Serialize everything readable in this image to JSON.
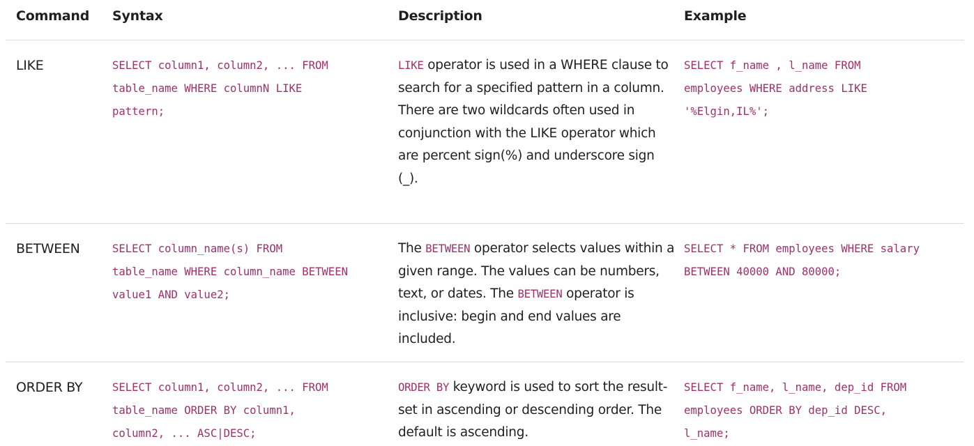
{
  "headers": {
    "command": "Command",
    "syntax": "Syntax",
    "description": "Description",
    "example": "Example"
  },
  "rows": [
    {
      "command": "LIKE",
      "syntax_lines": [
        "SELECT column1, column2, ... FROM",
        "table_name WHERE columnN LIKE",
        "pattern;"
      ],
      "description": {
        "kw1": "LIKE",
        "text1": " operator is used in a WHERE clause to search for a specified pattern in a column.",
        "text2": "There are two wildcards often used in conjunction with the LIKE operator which are percent sign(%) and underscore sign (_)."
      },
      "example_lines": [
        "SELECT f_name , l_name FROM",
        "employees WHERE address LIKE",
        "'%Elgin,IL%';"
      ]
    },
    {
      "command": "BETWEEN",
      "syntax_lines": [
        "SELECT column_name(s) FROM",
        "table_name WHERE column_name BETWEEN",
        "value1 AND value2;"
      ],
      "description": {
        "pre": "The ",
        "kw1": "BETWEEN",
        "text1": " operator selects values within a given range. The values can be numbers, text, or dates. The ",
        "kw2": "BETWEEN",
        "text2": " operator is inclusive: begin and end values are included."
      },
      "example_lines": [
        "SELECT * FROM employees WHERE salary",
        "BETWEEN 40000 AND 80000;"
      ]
    },
    {
      "command": "ORDER BY",
      "syntax_lines": [
        "SELECT column1, column2, ... FROM",
        "table_name ORDER BY column1,",
        "column2, ... ASC|DESC;"
      ],
      "description": {
        "kw1": "ORDER BY",
        "text1": " keyword is used to sort the result-set in ascending or descending order. The default is ascending."
      },
      "example_lines": [
        "SELECT f_name, l_name, dep_id FROM",
        "employees ORDER BY dep_id DESC,",
        "l_name;"
      ]
    }
  ],
  "colors": {
    "code": "#a0306a",
    "text": "#1f1f1f",
    "rule": "#dcdcdc"
  }
}
